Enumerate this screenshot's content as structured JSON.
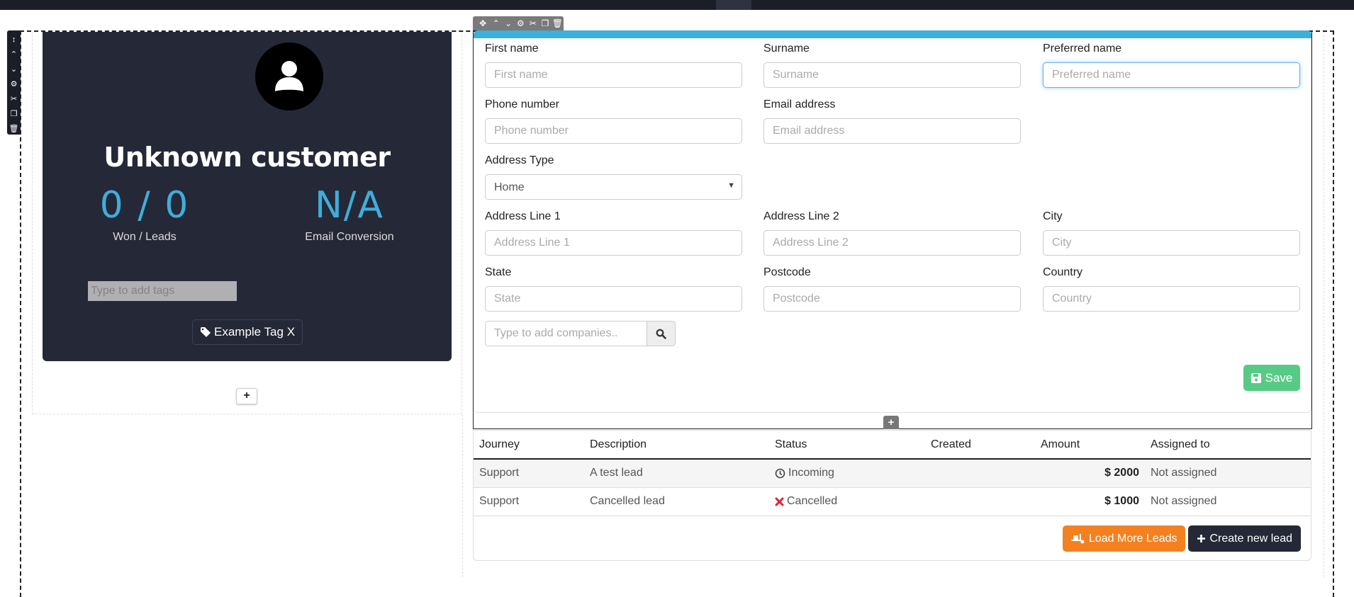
{
  "editor": {
    "row_toolbar_icons": [
      "resize-vertical-icon",
      "chevron-up-icon",
      "chevron-down-icon",
      "gear-icon",
      "scissors-icon",
      "copy-icon",
      "trash-icon"
    ],
    "block_toolbar_icons": [
      "move-icon",
      "chevron-up-icon",
      "chevron-down-icon",
      "gear-icon",
      "scissors-icon",
      "copy-icon",
      "trash-icon"
    ],
    "add_block_label": "+",
    "add_row_label": "+"
  },
  "customer_card": {
    "name": "Unknown customer",
    "stats": [
      {
        "value": "0 / 0",
        "label": "Won / Leads"
      },
      {
        "value": "N/A",
        "label": "Email Conversion"
      }
    ],
    "tag_input_placeholder": "Type to add tags",
    "tags": [
      {
        "label": "Example Tag X"
      }
    ]
  },
  "form": {
    "fields": {
      "first_name": {
        "label": "First name",
        "placeholder": "First name",
        "value": ""
      },
      "surname": {
        "label": "Surname",
        "placeholder": "Surname",
        "value": ""
      },
      "preferred_name": {
        "label": "Preferred name",
        "placeholder": "Preferred name",
        "value": "",
        "focused": true
      },
      "phone": {
        "label": "Phone number",
        "placeholder": "Phone number",
        "value": ""
      },
      "email": {
        "label": "Email address",
        "placeholder": "Email address",
        "value": ""
      },
      "address_type": {
        "label": "Address Type",
        "selected": "Home"
      },
      "address_line_1": {
        "label": "Address Line 1",
        "placeholder": "Address Line 1",
        "value": ""
      },
      "address_line_2": {
        "label": "Address Line 2",
        "placeholder": "Address Line 2",
        "value": ""
      },
      "city": {
        "label": "City",
        "placeholder": "City",
        "value": ""
      },
      "state": {
        "label": "State",
        "placeholder": "State",
        "value": ""
      },
      "postcode": {
        "label": "Postcode",
        "placeholder": "Postcode",
        "value": ""
      },
      "country": {
        "label": "Country",
        "placeholder": "Country",
        "value": ""
      }
    },
    "company_search_placeholder": "Type to add companies..",
    "save_label": "Save",
    "accent_color": "#3eaedb",
    "save_color": "#57cb85"
  },
  "leads": {
    "columns": [
      "Journey",
      "Description",
      "Status",
      "Created",
      "Amount",
      "Assigned to"
    ],
    "rows": [
      {
        "journey": "Support",
        "description": "A test lead",
        "status": "Incoming",
        "status_icon": "clock-icon",
        "created": "",
        "amount": "$ 2000",
        "assigned_to": "Not assigned"
      },
      {
        "journey": "Support",
        "description": "Cancelled lead",
        "status": "Cancelled",
        "status_icon": "x-icon",
        "created": "",
        "amount": "$ 1000",
        "assigned_to": "Not assigned"
      }
    ],
    "load_more_label": "Load More Leads",
    "create_label": "Create new lead",
    "load_more_color": "#f48120",
    "create_color": "#252836"
  }
}
